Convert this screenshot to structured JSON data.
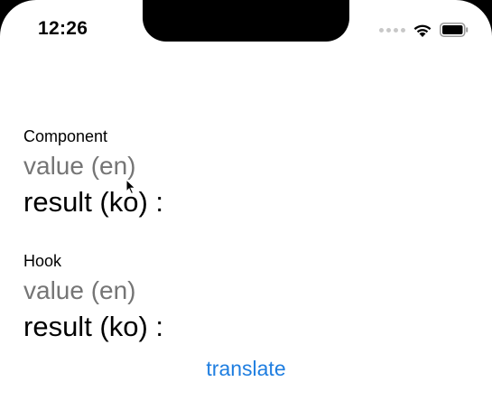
{
  "status_bar": {
    "time": "12:26",
    "icons": [
      "cellular-signal-icon",
      "wifi-icon",
      "battery-icon"
    ]
  },
  "component_section": {
    "label": "Component",
    "input_placeholder": "value (en)",
    "input_value": "",
    "result_label": "result (ko) :"
  },
  "hook_section": {
    "label": "Hook",
    "input_placeholder": "value (en)",
    "input_value": "",
    "result_label": "result (ko) :"
  },
  "translate_button": {
    "label": "translate"
  },
  "colors": {
    "accent": "#1f7ee0",
    "placeholder": "#c6c6c8",
    "text": "#000000",
    "background": "#ffffff"
  }
}
